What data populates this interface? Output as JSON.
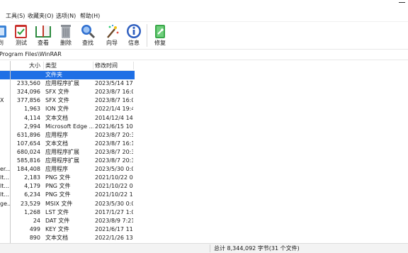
{
  "menu": [
    {
      "id": "tools",
      "label": "工具(S)"
    },
    {
      "id": "favorites",
      "label": "收藏夹(O)"
    },
    {
      "id": "options",
      "label": "选项(N)"
    },
    {
      "id": "help",
      "label": "帮助(H)"
    }
  ],
  "toolbar": {
    "buttons": [
      {
        "id": "extract-to",
        "label": "到",
        "icon": "extract-to-icon"
      },
      {
        "id": "test",
        "label": "测试",
        "icon": "test-icon"
      },
      {
        "id": "view",
        "label": "查看",
        "icon": "view-book-icon"
      },
      {
        "id": "delete",
        "label": "删除",
        "icon": "trash-icon"
      },
      {
        "id": "find",
        "label": "查找",
        "icon": "magnifier-icon"
      },
      {
        "id": "wizard",
        "label": "向导",
        "icon": "wand-icon"
      },
      {
        "id": "info",
        "label": "信息",
        "icon": "info-icon"
      },
      {
        "id": "repair",
        "label": "修复",
        "icon": "repair-icon"
      }
    ]
  },
  "address": {
    "path": "Program Files\\WinRAR"
  },
  "columns": {
    "name": "",
    "size": "大小",
    "type": "类型",
    "modified": "修改时间"
  },
  "files": [
    {
      "name": "",
      "size": "",
      "type": "文件夹",
      "modified": ""
    },
    {
      "name": "",
      "size": "233,560",
      "type": "应用程序扩展",
      "modified": "2023/5/14 17..."
    },
    {
      "name": "",
      "size": "324,096",
      "type": "SFX 文件",
      "modified": "2023/8/7 16:00"
    },
    {
      "name": "X",
      "size": "377,856",
      "type": "SFX 文件",
      "modified": "2023/8/7 16:01"
    },
    {
      "name": "",
      "size": "1,963",
      "type": "ION 文件",
      "modified": "2022/1/4 19:48"
    },
    {
      "name": "",
      "size": "4,114",
      "type": "文本文档",
      "modified": "2014/12/4 14..."
    },
    {
      "name": "",
      "size": "2,994",
      "type": "Microsoft Edge ...",
      "modified": "2021/6/15 10..."
    },
    {
      "name": "",
      "size": "631,896",
      "type": "应用程序",
      "modified": "2023/8/7 20:34"
    },
    {
      "name": "",
      "size": "107,654",
      "type": "文本文档",
      "modified": "2023/8/7 16:12"
    },
    {
      "name": "",
      "size": "680,024",
      "type": "应用程序扩展",
      "modified": "2023/8/7 20:34"
    },
    {
      "name": "",
      "size": "585,816",
      "type": "应用程序扩展",
      "modified": "2023/8/7 20:34"
    },
    {
      "name": "er...",
      "size": "184,408",
      "type": "应用程序",
      "modified": "2023/5/30 0:03"
    },
    {
      "name": "lt...",
      "size": "2,183",
      "type": "PNG 文件",
      "modified": "2021/10/22 0..."
    },
    {
      "name": "lt...",
      "size": "4,179",
      "type": "PNG 文件",
      "modified": "2021/10/22 0..."
    },
    {
      "name": "lt...",
      "size": "6,234",
      "type": "PNG 文件",
      "modified": "2021/10/22 1..."
    },
    {
      "name": "ge...",
      "size": "23,529",
      "type": "MSIX 文件",
      "modified": "2023/5/30 0:03"
    },
    {
      "name": "",
      "size": "1,268",
      "type": "LST 文件",
      "modified": "2017/1/27 1:02"
    },
    {
      "name": "",
      "size": "24",
      "type": "DAT 文件",
      "modified": "2023/8/9 7:21"
    },
    {
      "name": "",
      "size": "499",
      "type": "KEY 文件",
      "modified": "2021/6/17 11..."
    },
    {
      "name": "",
      "size": "890",
      "type": "文本文档",
      "modified": "2022/1/26 13..."
    }
  ],
  "status": {
    "text": "总计 8,344,092 字节(31 个文件)"
  },
  "colors": {
    "selection": "#1f6fe5",
    "status_bg": "#f3f3f3"
  }
}
